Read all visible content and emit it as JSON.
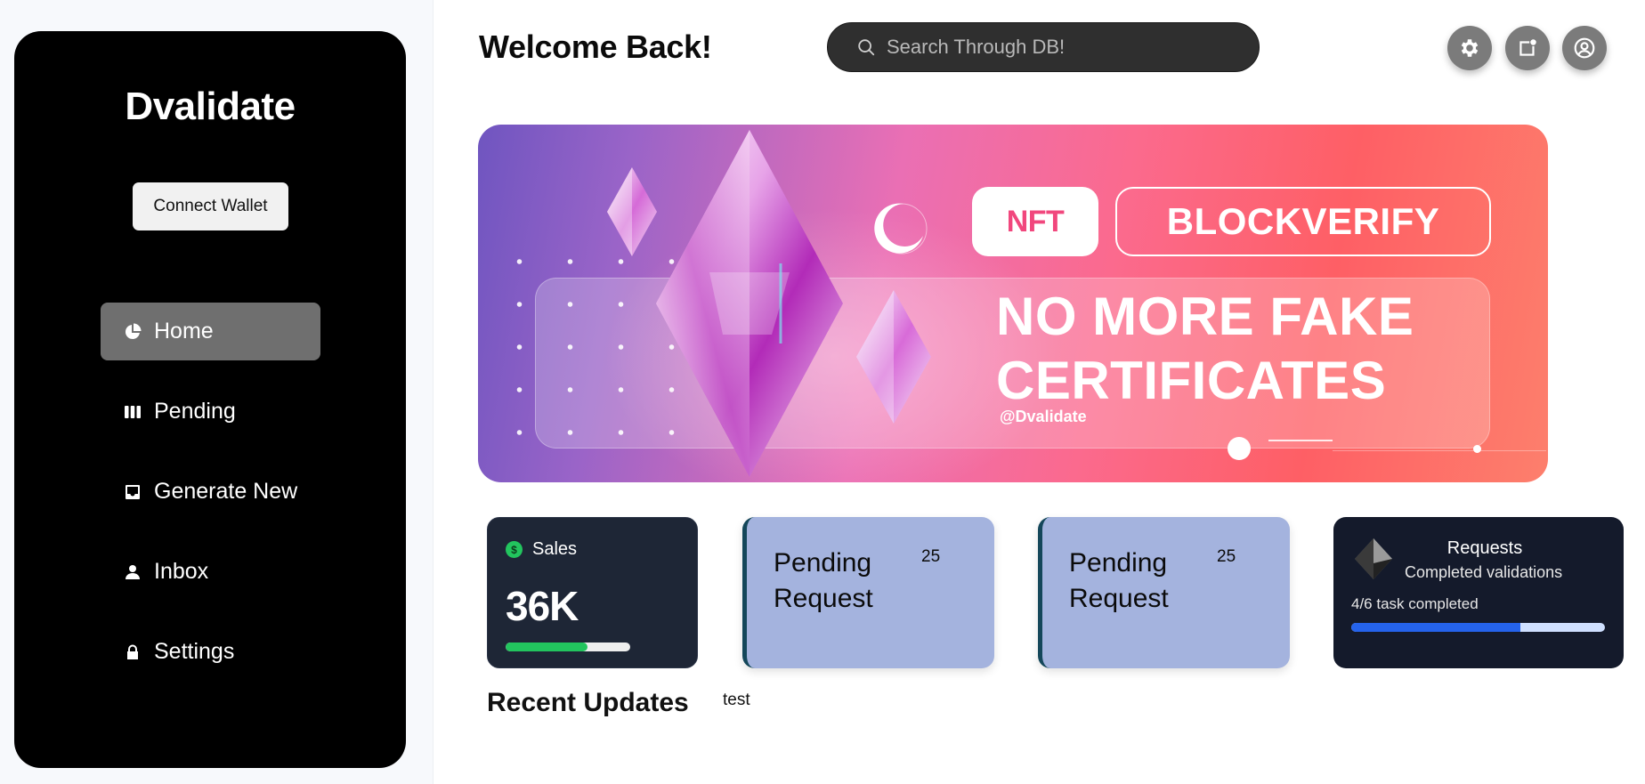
{
  "sidebar": {
    "brand": "Dvalidate",
    "connect_label": "Connect Wallet",
    "items": [
      {
        "label": "Home",
        "icon": "pie-chart-icon",
        "active": true
      },
      {
        "label": "Pending",
        "icon": "columns-icon"
      },
      {
        "label": "Generate New",
        "icon": "inbox-tray-icon"
      },
      {
        "label": "Inbox",
        "icon": "person-icon"
      },
      {
        "label": "Settings",
        "icon": "lock-icon"
      }
    ]
  },
  "header": {
    "welcome": "Welcome Back!",
    "search_placeholder": "Search Through DB!",
    "buttons": [
      "gear-icon",
      "notification-icon",
      "user-circle-icon"
    ]
  },
  "banner": {
    "nft": "NFT",
    "brand": "BLOCKVERIFY",
    "headline_line1": "NO MORE FAKE",
    "headline_line2": "CERTIFICATES",
    "handle": "@Dvalidate"
  },
  "cards": {
    "sales": {
      "label": "Sales",
      "value": "36K",
      "progress": 0.66,
      "bar_color": "#22c55e"
    },
    "pending": [
      {
        "line1": "Pending",
        "line2": "Request",
        "count": "25"
      },
      {
        "line1": "Pending",
        "line2": "Request",
        "count": "25"
      }
    ],
    "requests": {
      "title": "Requests",
      "subtitle": "Completed validations",
      "progress_text": "4/6 task completed",
      "progress": 0.6667,
      "bar_color": "#2563eb"
    }
  },
  "recent": {
    "title": "Recent Updates",
    "note": "test"
  }
}
